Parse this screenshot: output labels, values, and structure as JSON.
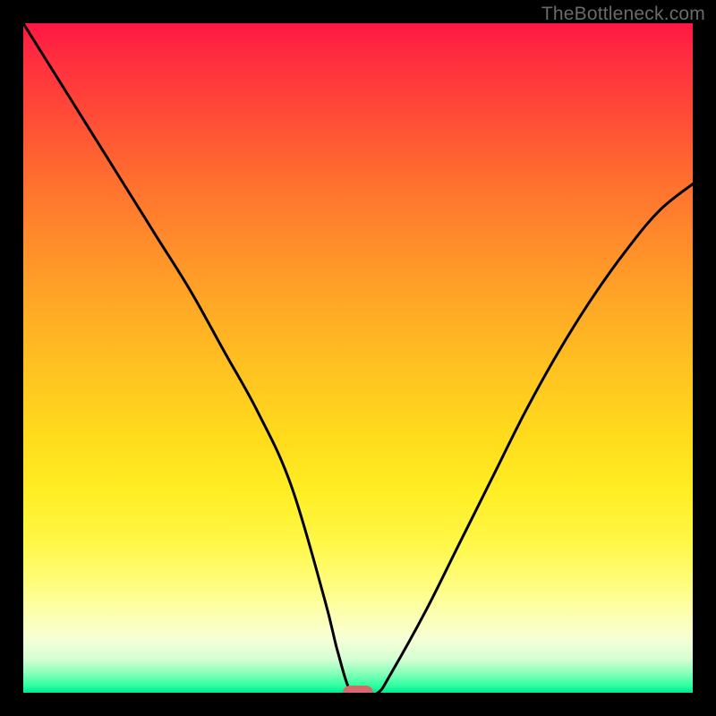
{
  "watermark": {
    "text": "TheBottleneck.com"
  },
  "chart_data": {
    "type": "line",
    "title": "",
    "xlabel": "",
    "ylabel": "",
    "xlim": [
      0,
      100
    ],
    "ylim": [
      0,
      100
    ],
    "grid": false,
    "legend": false,
    "series": [
      {
        "name": "bottleneck-curve",
        "x": [
          0,
          5,
          10,
          15,
          20,
          25,
          30,
          35,
          40,
          45,
          47,
          49,
          51,
          53,
          55,
          60,
          65,
          70,
          75,
          80,
          85,
          90,
          95,
          100
        ],
        "values": [
          100,
          92,
          84,
          76,
          68,
          60,
          51,
          42,
          31,
          14,
          6,
          0,
          0,
          0,
          3,
          12,
          22,
          32,
          42,
          51,
          59,
          66,
          72,
          76
        ]
      }
    ],
    "annotations": [
      {
        "name": "optimal-marker",
        "x": 50,
        "y": 0
      }
    ],
    "background": {
      "type": "vertical-gradient",
      "stops": [
        {
          "pos": 0,
          "color": "#ff1744"
        },
        {
          "pos": 50,
          "color": "#ffc321"
        },
        {
          "pos": 80,
          "color": "#fffd80"
        },
        {
          "pos": 100,
          "color": "#00e890"
        }
      ]
    }
  }
}
